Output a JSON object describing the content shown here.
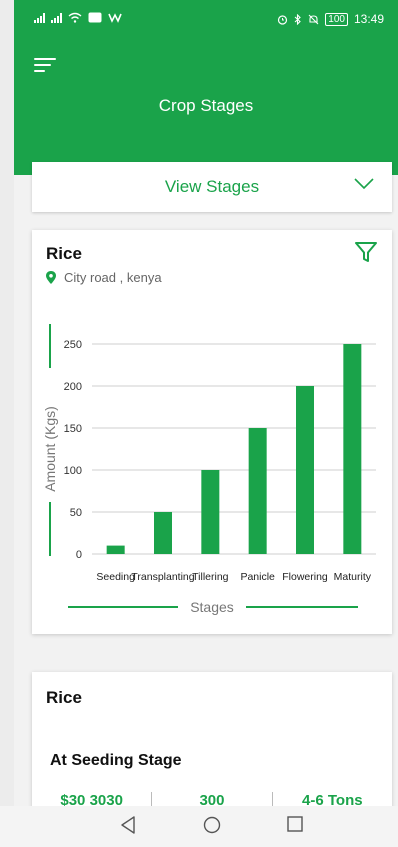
{
  "status_bar": {
    "time": "13:49",
    "battery": "100"
  },
  "header": {
    "title": "Crop Stages"
  },
  "dropdown": {
    "label": "View Stages"
  },
  "chart_card": {
    "crop": "Rice",
    "location": "City road , kenya"
  },
  "chart_data": {
    "type": "bar",
    "categories": [
      "Seeding",
      "Transplanting",
      "Tillering",
      "Panicle",
      "Flowering",
      "Maturity"
    ],
    "values": [
      10,
      50,
      100,
      150,
      200,
      250
    ],
    "xlabel": "Stages",
    "ylabel": "Amount (Kgs)",
    "ylim": [
      0,
      250
    ],
    "yticks": [
      0,
      50,
      100,
      150,
      200,
      250
    ],
    "grid": true,
    "color": "#1aa34a"
  },
  "info_card": {
    "crop": "Rice",
    "stage_title": "At Seeding Stage",
    "stats": [
      "$30 3030",
      "300",
      "4-6 Tons"
    ]
  },
  "colors": {
    "brand": "#1aa34a"
  }
}
